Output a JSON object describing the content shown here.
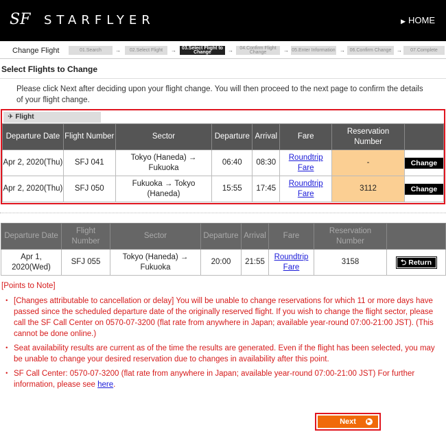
{
  "header": {
    "logo_mark": "SF",
    "logo_text": "STARFLYER",
    "home_label": "HOME"
  },
  "steps": {
    "label": "Change Flight",
    "items": [
      {
        "label": "01.Search"
      },
      {
        "label": "02.Select Flight"
      },
      {
        "label": "03.Select Flight to Change"
      },
      {
        "label": "04.Confirm Flight Change"
      },
      {
        "label": "05.Enter Information"
      },
      {
        "label": "06.Confirm Change"
      },
      {
        "label": "07.Complete"
      }
    ]
  },
  "page_title": "Select Flights to Change",
  "intro": "Please click Next after deciding upon your flight change. You will then proceed to the next page to confirm the details of your flight change.",
  "selected": {
    "tab_label": "Flight",
    "headers": [
      "Departure Date",
      "Flight Number",
      "Sector",
      "Departure",
      "Arrival",
      "Fare",
      "Reservation Number",
      ""
    ],
    "rows": [
      {
        "date": "Apr 2, 2020(Thu)",
        "flight": "SFJ 041",
        "sector": "Tokyo (Haneda) → Fukuoka",
        "dep": "06:40",
        "arr": "08:30",
        "fare": "Roundtrip Fare",
        "resv": "-",
        "button": "Change"
      },
      {
        "date": "Apr 2, 2020(Thu)",
        "flight": "SFJ 050",
        "sector": "Fukuoka → Tokyo (Haneda)",
        "dep": "15:55",
        "arr": "17:45",
        "fare": "Roundtrip Fare",
        "resv": "3112",
        "button": "Change"
      }
    ]
  },
  "other": {
    "headers": [
      "Departure Date",
      "Flight Number",
      "Sector",
      "Departure",
      "Arrival",
      "Fare",
      "Reservation Number",
      ""
    ],
    "rows": [
      {
        "date": "Apr 1, 2020(Wed)",
        "flight": "SFJ 055",
        "sector": "Tokyo (Haneda) → Fukuoka",
        "dep": "20:00",
        "arr": "21:55",
        "fare": "Roundtrip Fare",
        "resv": "3158",
        "button": "Return"
      }
    ]
  },
  "notes": {
    "title": "[Points to Note]",
    "items": [
      "[Changes attributable to cancellation or delay] You will be unable to change reservations for which 11 or more days have passed since the scheduled departure date of the originally reserved flight. If you wish to change the flight sector, please call the SF Call Center on 0570-07-3200 (flat rate from anywhere in Japan; available year-round 07:00-21:00 JST). (This cannot be done online.)",
      "Seat availability results are current as of the time the results are generated. Even if the flight has been selected, you may be unable to change your desired reservation due to changes in availability after this point."
    ],
    "last_item_prefix": "SF Call Center: 0570-07-3200 (flat rate from anywhere in Japan; available year-round 07:00-21:00 JST) For further information, please see",
    "last_item_link": "here",
    "last_item_suffix": "."
  },
  "next_label": "Next",
  "colors": {
    "accent": "#f06a0a",
    "highlight_border": "#e0141e",
    "reservation_cell": "#fbcf93",
    "note_text": "#d61a1a"
  }
}
